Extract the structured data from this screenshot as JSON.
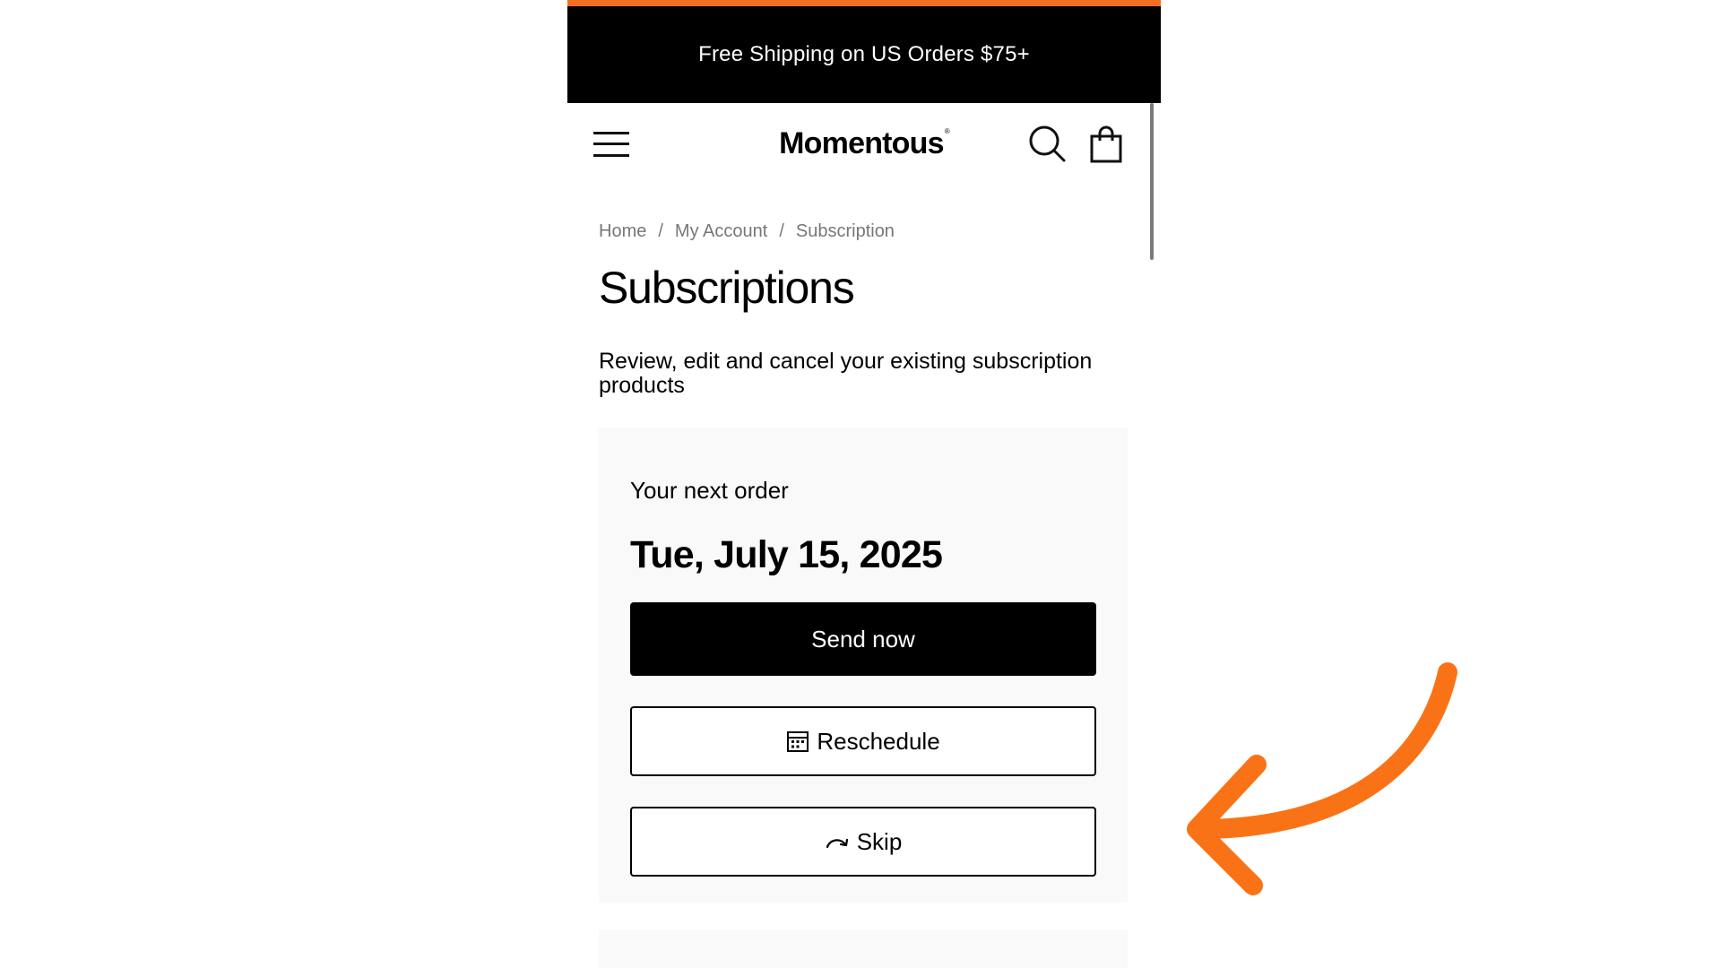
{
  "promo": {
    "text": "Free Shipping on US Orders $75+"
  },
  "header": {
    "logo": "Momentous",
    "logo_mark": "®"
  },
  "breadcrumb": {
    "items": [
      "Home",
      "My Account",
      "Subscription"
    ],
    "separator": "/"
  },
  "page": {
    "title": "Subscriptions",
    "description": "Review, edit and cancel your existing subscription products"
  },
  "next_order": {
    "label": "Your next order",
    "date": "Tue, July 15, 2025",
    "send_now_label": "Send now",
    "reschedule_label": "Reschedule",
    "skip_label": "Skip"
  },
  "icons": {
    "menu": "hamburger-menu-icon",
    "search": "search-icon",
    "cart": "shopping-bag-icon",
    "reschedule": "calendar-icon",
    "skip": "skip-arrow-icon",
    "annotation": "curved-arrow-icon"
  },
  "colors": {
    "accent": "#f36f21",
    "promo_bg": "#000000",
    "card_bg": "#f9f9f9",
    "primary_button": "#000000"
  }
}
